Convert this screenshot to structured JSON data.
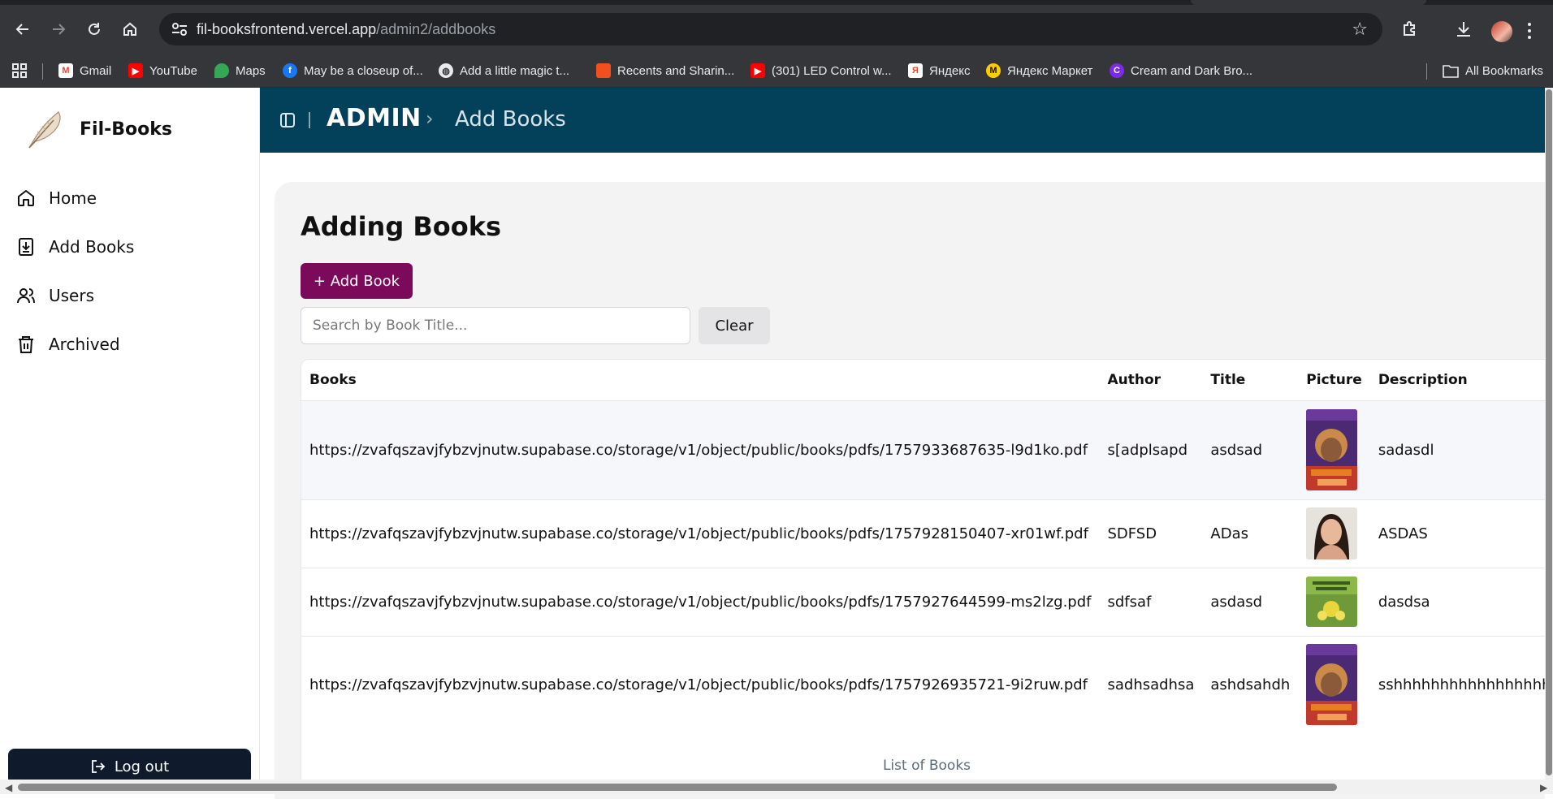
{
  "browser": {
    "url_host": "fil-booksfrontend.vercel.app",
    "url_path": "/admin2/addbooks",
    "bookmarks": [
      {
        "label": "Gmail",
        "icon": "gmail-icon",
        "color": "#ea4335"
      },
      {
        "label": "YouTube",
        "icon": "youtube-icon",
        "color": "#ff0000"
      },
      {
        "label": "Maps",
        "icon": "maps-icon",
        "color": "#34a853"
      },
      {
        "label": "May be a closeup of...",
        "icon": "facebook-icon",
        "color": "#1877f2"
      },
      {
        "label": "Add a little magic t...",
        "icon": "globe-icon",
        "color": "#9aa0a6"
      },
      {
        "label": "Recents and Sharin...",
        "icon": "figma-icon",
        "color": "#f24e1e"
      },
      {
        "label": "(301) LED Control w...",
        "icon": "youtube-icon",
        "color": "#ff0000"
      },
      {
        "label": "Яндекс",
        "icon": "yandex-icon",
        "color": "#fc3f1d"
      },
      {
        "label": "Яндекс Маркет",
        "icon": "yandex-market-icon",
        "color": "#ffcc00"
      },
      {
        "label": "Cream and Dark Bro...",
        "icon": "canva-icon",
        "color": "#7d2ae8"
      }
    ],
    "all_bookmarks": "All Bookmarks"
  },
  "sidebar": {
    "brand": "Fil-Books",
    "items": [
      {
        "label": "Home",
        "icon": "home-icon"
      },
      {
        "label": "Add Books",
        "icon": "add-book-icon"
      },
      {
        "label": "Users",
        "icon": "users-icon"
      },
      {
        "label": "Archived",
        "icon": "trash-icon"
      }
    ],
    "logout": "Log out"
  },
  "header": {
    "title": "ADMIN",
    "crumb": "Add Books",
    "color": "#03405a"
  },
  "main": {
    "title": "Adding Books",
    "add_button": "+ Add Book",
    "search_placeholder": "Search by Book Title...",
    "clear_button": "Clear",
    "table": {
      "columns": [
        "Books",
        "Author",
        "Title",
        "Picture",
        "Description"
      ],
      "rows": [
        {
          "book": "https://zvafqszavjfybzvjnutw.supabase.co/storage/v1/object/public/books/pdfs/1757933687635-l9d1ko.pdf",
          "author": "s[adplsapd",
          "title": "asdsad",
          "picture": "book-cover-banaag-at-sikat",
          "description": "sadasdl"
        },
        {
          "book": "https://zvafqszavjfybzvjnutw.supabase.co/storage/v1/object/public/books/pdfs/1757928150407-xr01wf.pdf",
          "author": "SDFSD",
          "title": "ADas",
          "picture": "portrait-photo",
          "description": "ASDAS"
        },
        {
          "book": "https://zvafqszavjfybzvjnutw.supabase.co/storage/v1/object/public/books/pdfs/1757927644599-ms2lzg.pdf",
          "author": "sdfsaf",
          "title": "asdasd",
          "picture": "book-cover-alamat-ng-kamyas",
          "description": "dasdsa"
        },
        {
          "book": "https://zvafqszavjfybzvjnutw.supabase.co/storage/v1/object/public/books/pdfs/1757926935721-9i2ruw.pdf",
          "author": "sadhsadhsa",
          "title": "ashdsahdh",
          "picture": "book-cover-banaag-at-sikat",
          "description": "sshhhhhhhhhhhhhhhhhhhh"
        }
      ],
      "caption": "List of Books"
    },
    "add_button_color": "#7b0a5a"
  }
}
